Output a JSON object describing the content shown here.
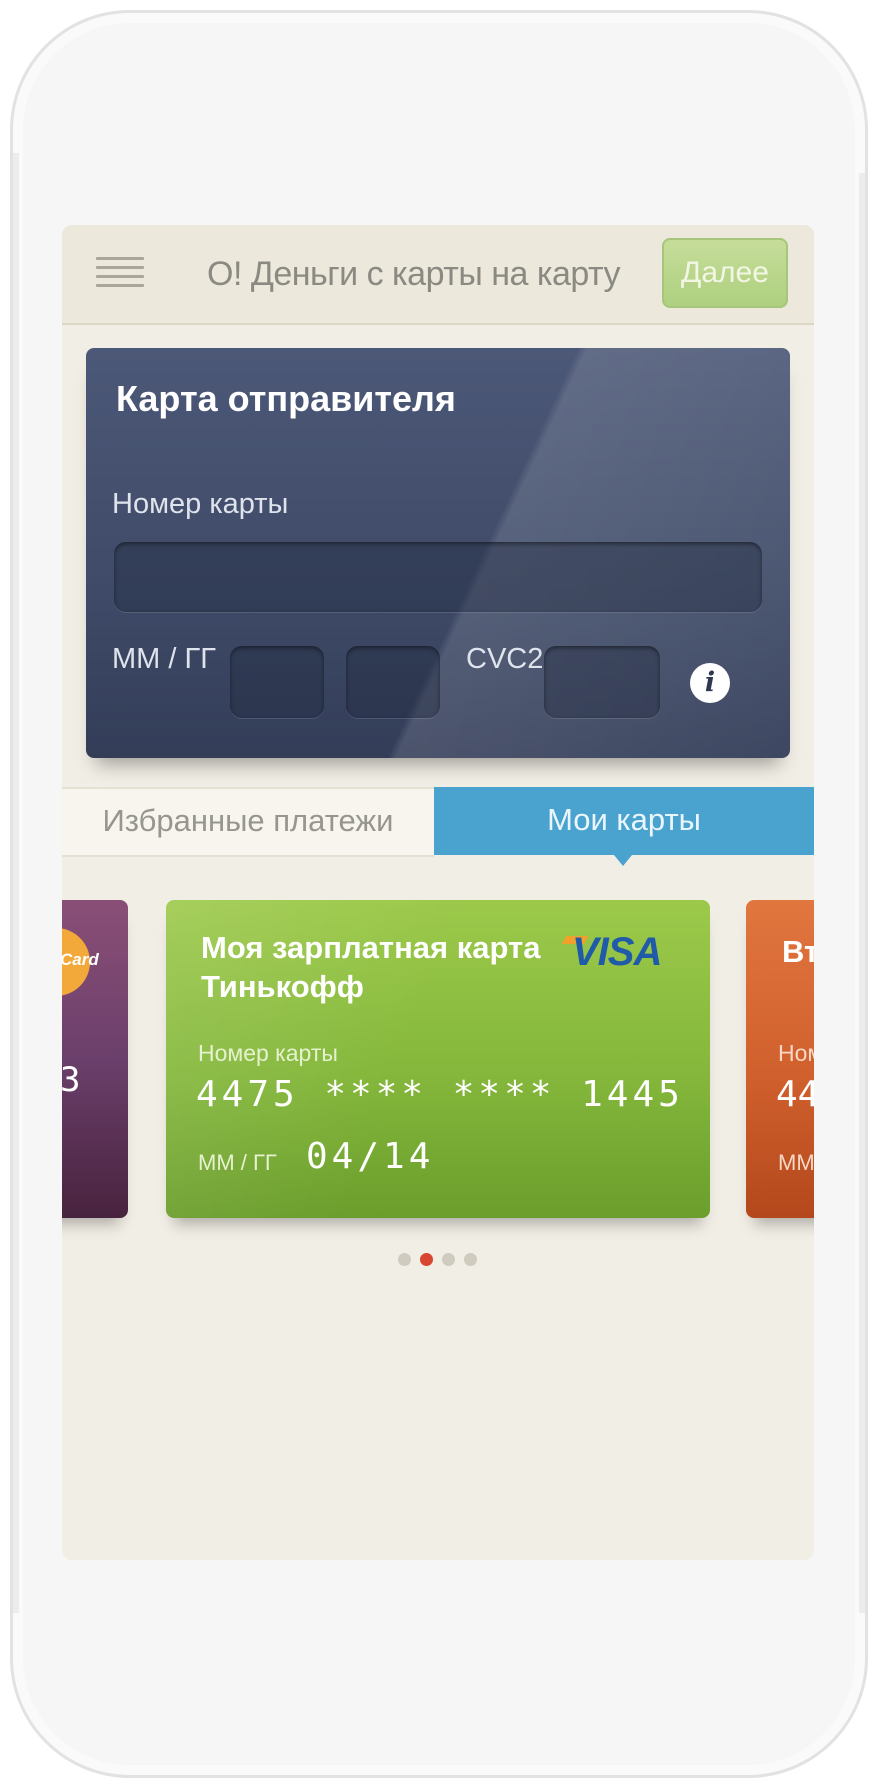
{
  "header": {
    "title": "О! Деньги с карты на карту",
    "next_label": "Далее"
  },
  "sender_card": {
    "title": "Карта отправителя",
    "card_number_label": "Номер карты",
    "card_number_value": "",
    "expiry_label": "ММ / ГГ",
    "cvc_label": "CVC2",
    "info_glyph": "i"
  },
  "tabs": [
    {
      "label": "Избранные платежи",
      "active": false
    },
    {
      "label": "Мои карты",
      "active": true
    }
  ],
  "cards": [
    {
      "brand_fragment": "Card",
      "number_fragment": "3",
      "color": "#6b3f6b"
    },
    {
      "name": "Моя зарплатная карта Тинькофф",
      "brand": "VISA",
      "number_label": "Номер карты",
      "number": "4475 **** **** 1445",
      "expiry_label": "ММ / ГГ",
      "expiry": "04/14",
      "color": "#84b73b"
    },
    {
      "name_fragment": "Вт",
      "number_label_fragment": "Ном",
      "number_fragment": "44",
      "expiry_label_fragment": "ММ",
      "color": "#d0602d"
    }
  ],
  "pagination": {
    "total": 4,
    "active_index": 1
  },
  "colors": {
    "accent_blue": "#4aa3cf",
    "next_green": "#aed07f",
    "dot_active": "#d8462f"
  }
}
